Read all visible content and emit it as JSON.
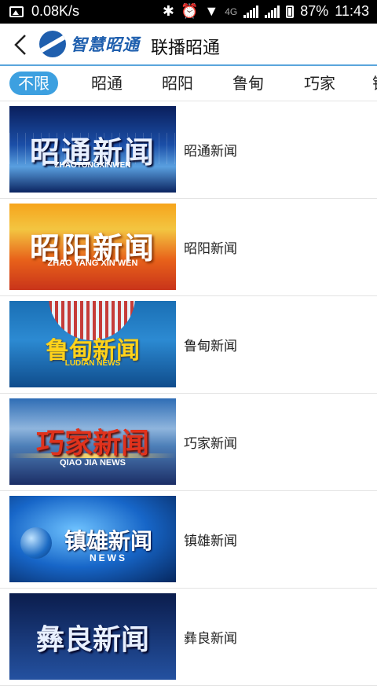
{
  "status_bar": {
    "speed": "0.08K/s",
    "network_type": "4G",
    "battery": "87%",
    "time": "11:43"
  },
  "header": {
    "logo_text": "智慧昭通",
    "title": "联播昭通"
  },
  "tabs": [
    {
      "label": "不限",
      "active": true
    },
    {
      "label": "昭通",
      "active": false
    },
    {
      "label": "昭阳",
      "active": false
    },
    {
      "label": "鲁甸",
      "active": false
    },
    {
      "label": "巧家",
      "active": false
    },
    {
      "label": "镇",
      "active": false
    }
  ],
  "items": [
    {
      "title": "昭通新闻",
      "thumb_text": "昭通新闻",
      "thumb_sub": "ZHAOTONGXINWEN"
    },
    {
      "title": "昭阳新闻",
      "thumb_text": "昭阳新闻",
      "thumb_sub": "ZHAO YANG XIN WEN"
    },
    {
      "title": "鲁甸新闻",
      "thumb_text": "鲁甸新闻",
      "thumb_sub": "LUDIAN NEWS"
    },
    {
      "title": "巧家新闻",
      "thumb_text": "巧家新闻",
      "thumb_sub": "QIAO JIA NEWS"
    },
    {
      "title": "镇雄新闻",
      "thumb_text": "镇雄新闻",
      "thumb_sub": "NEWS"
    },
    {
      "title": "彝良新闻",
      "thumb_text": "彝良新闻"
    }
  ]
}
